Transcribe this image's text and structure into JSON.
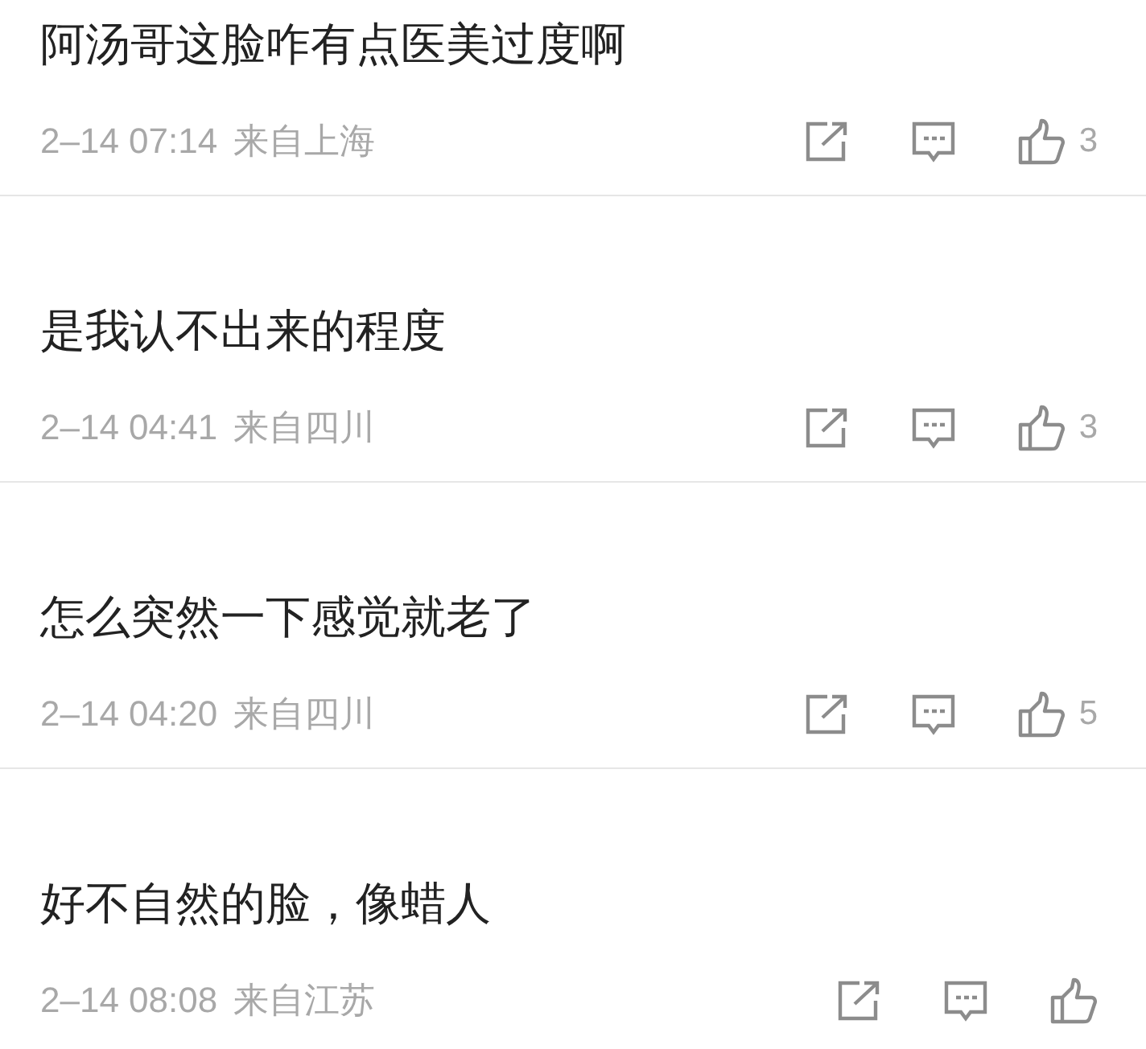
{
  "comments": [
    {
      "text": "阿汤哥这脸咋有点医美过度啊",
      "time": "2–14 07:14",
      "location": "来自上海",
      "likes": "3"
    },
    {
      "text": "是我认不出来的程度",
      "time": "2–14 04:41",
      "location": "来自四川",
      "likes": "3"
    },
    {
      "text": "怎么突然一下感觉就老了",
      "time": "2–14 04:20",
      "location": "来自四川",
      "likes": "5"
    },
    {
      "text": "好不自然的脸，像蜡人",
      "time": "2–14 08:08",
      "location": "来自江苏"
    }
  ]
}
